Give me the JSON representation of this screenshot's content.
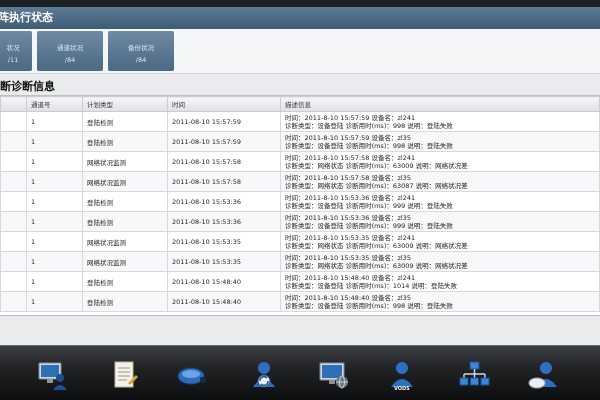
{
  "panel": {
    "title": "阵执行状态"
  },
  "status_cards": [
    {
      "title": "状况",
      "value": "/11"
    },
    {
      "title": "通道状况",
      "value": "/84"
    },
    {
      "title": "备份状况",
      "value": "/84"
    }
  ],
  "diag": {
    "title": "断诊断信息"
  },
  "table": {
    "headers": [
      "",
      "通道号",
      "计划类型",
      "时间",
      "描述信息"
    ],
    "rows": [
      {
        "ch": "1",
        "type": "登陆检测",
        "time": "2011-08-10 15:57:59",
        "d1": "时间：2011-8-10 15:57:59 设备名：zl241",
        "d2": "诊断类型：设备登陆  诊断用时(ms)：998 说明：登陆失败"
      },
      {
        "ch": "1",
        "type": "登陆检测",
        "time": "2011-08-10 15:57:59",
        "d1": "时间：2011-8-10 15:57:59 设备名：zl35",
        "d2": "诊断类型：设备登陆  诊断用时(ms)：998 说明：登陆失败"
      },
      {
        "ch": "1",
        "type": "网络状况监测",
        "time": "2011-08-10 15:57:58",
        "d1": "时间：2011-8-10 15:57:58 设备名：zl241",
        "d2": "诊断类型：网络状态  诊断用时(ms)：63009 说明：网络状况差"
      },
      {
        "ch": "1",
        "type": "网络状况监测",
        "time": "2011-08-10 15:57:58",
        "d1": "时间：2011-8-10 15:57:58 设备名：zl35",
        "d2": "诊断类型：网络状态  诊断用时(ms)：63087 说明：网络状况差"
      },
      {
        "ch": "1",
        "type": "登陆检测",
        "time": "2011-08-10 15:53:36",
        "d1": "时间：2011-8-10 15:53:36 设备名：zl241",
        "d2": "诊断类型：设备登陆  诊断用时(ms)：999 说明：登陆失败"
      },
      {
        "ch": "1",
        "type": "登陆检测",
        "time": "2011-08-10 15:53:36",
        "d1": "时间：2011-8-10 15:53:36 设备名：zl35",
        "d2": "诊断类型：设备登陆  诊断用时(ms)：999 说明：登陆失败"
      },
      {
        "ch": "1",
        "type": "网络状况监测",
        "time": "2011-08-10 15:53:35",
        "d1": "时间：2011-8-10 15:53:35 设备名：zl241",
        "d2": "诊断类型：网络状态  诊断用时(ms)：63009 说明：网络状况差"
      },
      {
        "ch": "1",
        "type": "网络状况监测",
        "time": "2011-08-10 15:53:35",
        "d1": "时间：2011-8-10 15:53:35 设备名：zl35",
        "d2": "诊断类型：网络状态  诊断用时(ms)：63009 说明：网络状况差"
      },
      {
        "ch": "1",
        "type": "登陆检测",
        "time": "2011-08-10 15:48:40",
        "d1": "时间：2011-8-10 15:48:40 设备名：zl241",
        "d2": "诊断类型：设备登陆  诊断用时(ms)：1014 说明：登陆失败"
      },
      {
        "ch": "1",
        "type": "登陆检测",
        "time": "2011-08-10 15:48:40",
        "d1": "时间：2011-8-10 15:48:40 设备名：zl35",
        "d2": "诊断类型：设备登陆  诊断用时(ms)：998 说明：登陆失败"
      }
    ]
  },
  "dock": {
    "items": [
      {
        "icon": "monitor-user-icon"
      },
      {
        "icon": "document-icon"
      },
      {
        "icon": "camera-icon"
      },
      {
        "icon": "user-sync-icon"
      },
      {
        "icon": "monitor-globe-icon"
      },
      {
        "icon": "vods-user-icon",
        "label": "VODS"
      },
      {
        "icon": "network-tree-icon"
      },
      {
        "icon": "user-cloud-icon"
      }
    ]
  },
  "colors": {
    "header": "#4a6883",
    "accent": "#3b79c7",
    "dock": "#1f2123"
  }
}
